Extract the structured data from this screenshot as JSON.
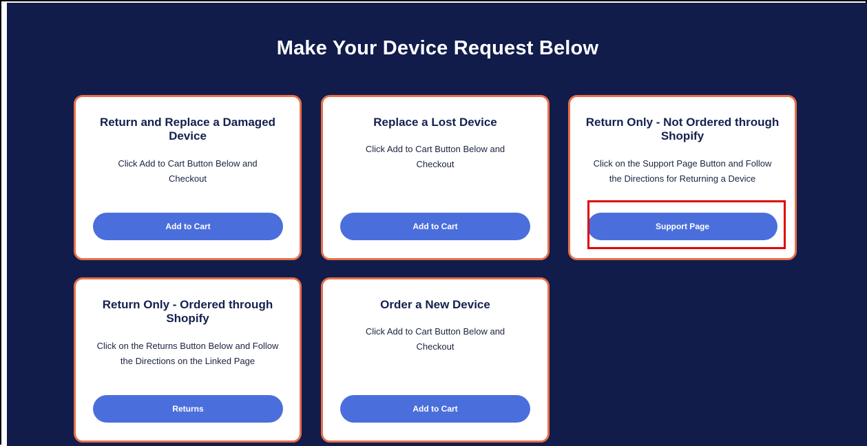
{
  "page": {
    "title": "Make Your Device Request Below"
  },
  "cards": [
    {
      "title": "Return and Replace a Damaged Device",
      "description": "Click Add to Cart Button Below and Checkout",
      "button_label": "Add to Cart"
    },
    {
      "title": "Replace a Lost Device",
      "description": "Click Add to Cart Button Below and Checkout",
      "button_label": "Add to Cart"
    },
    {
      "title": "Return Only - Not Ordered through Shopify",
      "description": "Click on the Support Page Button and Follow the Directions for Returning a Device",
      "button_label": "Support Page"
    },
    {
      "title": "Return Only - Ordered through Shopify",
      "description": "Click on the Returns Button Below and Follow the Directions on the Linked Page",
      "button_label": "Returns"
    },
    {
      "title": "Order a New Device",
      "description": "Click Add to Cart Button Below and Checkout",
      "button_label": "Add to Cart"
    }
  ],
  "colors": {
    "background": "#111c4b",
    "card_border": "#e8704a",
    "button": "#4a6fdc",
    "highlight": "#e00000",
    "title_text": "#14204f"
  }
}
